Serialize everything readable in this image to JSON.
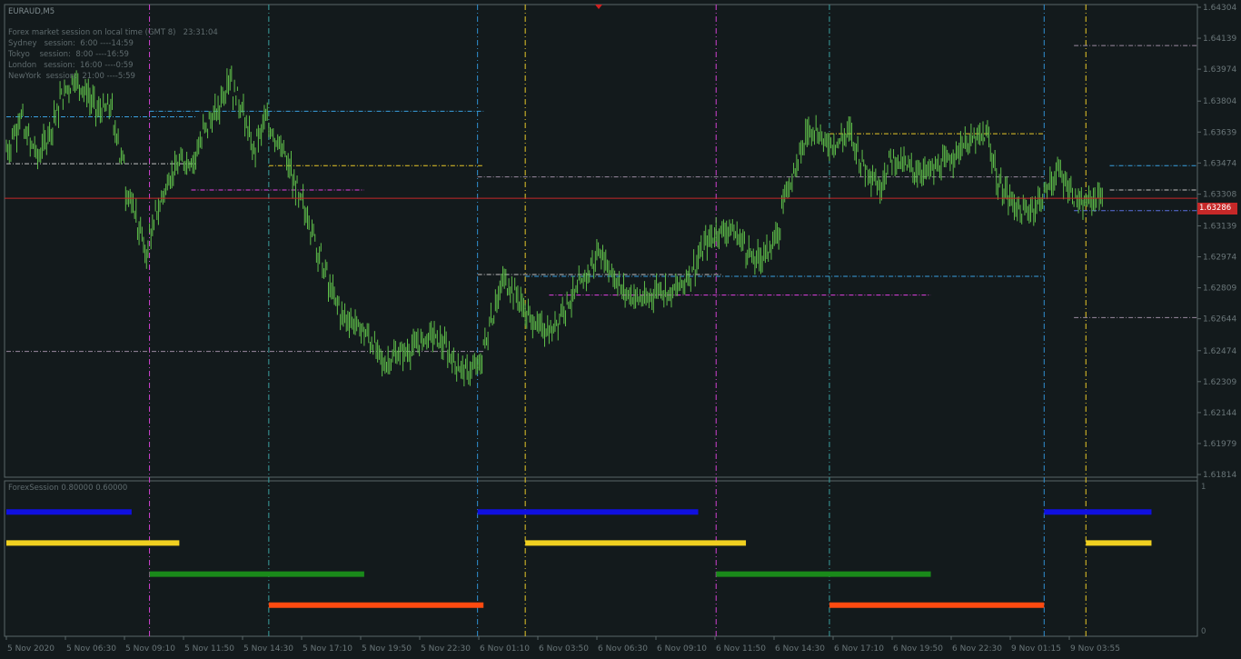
{
  "symbol": "EURAUD,M5",
  "info_lines": [
    "Forex market session on local time (GMT 8)   23:31:04",
    "Sydney   session:  6:00 ----14:59",
    "Tokyo    session:  8:00 ----16:59",
    "London   session:  16:00 ----0:59",
    "NewYork  session:  21:00 ----5:59"
  ],
  "current_price": "1.63286",
  "indicator": {
    "title": "ForexSession 0.80000 0.60000",
    "scale_top": "1",
    "scale_bottom": "0"
  },
  "colors": {
    "background": "#131a1c",
    "candle": "#5fbf4a",
    "sydney": "#1010e0",
    "tokyo": "#f0d020",
    "london": "#1a8a1a",
    "newyork": "#ff4a10",
    "price_line": "#c62828"
  },
  "chart_data": {
    "type": "bar",
    "title": "EURAUD,M5",
    "price_axis_ticks": [
      "1.64304",
      "1.64139",
      "1.63974",
      "1.63804",
      "1.63639",
      "1.63474",
      "1.63308",
      "1.63139",
      "1.62974",
      "1.62809",
      "1.62644",
      "1.62474",
      "1.62309",
      "1.62144",
      "1.61979",
      "1.61814"
    ],
    "time_axis_ticks": [
      "5 Nov 2020",
      "5 Nov 06:30",
      "5 Nov 09:10",
      "5 Nov 11:50",
      "5 Nov 14:30",
      "5 Nov 17:10",
      "5 Nov 19:50",
      "5 Nov 22:30",
      "6 Nov 01:10",
      "6 Nov 03:50",
      "6 Nov 06:30",
      "6 Nov 09:10",
      "6 Nov 11:50",
      "6 Nov 14:30",
      "6 Nov 17:10",
      "6 Nov 19:50",
      "6 Nov 22:30",
      "9 Nov 01:15",
      "9 Nov 03:55"
    ],
    "ylim": [
      1.61814,
      1.64304
    ],
    "current_price": 1.63286,
    "price_path": [
      [
        0,
        1.6355
      ],
      [
        2,
        1.6372
      ],
      [
        3,
        1.6362
      ],
      [
        5,
        1.6351
      ],
      [
        7,
        1.6365
      ],
      [
        9,
        1.6383
      ],
      [
        11,
        1.6392
      ],
      [
        13,
        1.6385
      ],
      [
        15,
        1.6375
      ],
      [
        17,
        1.6377
      ],
      [
        19,
        1.635
      ],
      [
        20,
        1.6331
      ],
      [
        21,
        1.6322
      ],
      [
        23,
        1.63
      ],
      [
        25,
        1.6322
      ],
      [
        27,
        1.634
      ],
      [
        29,
        1.6348
      ],
      [
        31,
        1.6349
      ],
      [
        33,
        1.6366
      ],
      [
        35,
        1.6375
      ],
      [
        37,
        1.6393
      ],
      [
        38,
        1.6384
      ],
      [
        39,
        1.6378
      ],
      [
        41,
        1.6354
      ],
      [
        43,
        1.637
      ],
      [
        45,
        1.636
      ],
      [
        47,
        1.6345
      ],
      [
        48,
        1.6335
      ],
      [
        50,
        1.632
      ],
      [
        52,
        1.63
      ],
      [
        54,
        1.628
      ],
      [
        56,
        1.6266
      ],
      [
        58,
        1.6262
      ],
      [
        60,
        1.6256
      ],
      [
        62,
        1.6246
      ],
      [
        63,
        1.624
      ],
      [
        65,
        1.6245
      ],
      [
        67,
        1.6247
      ],
      [
        69,
        1.6252
      ],
      [
        71,
        1.6256
      ],
      [
        73,
        1.625
      ],
      [
        75,
        1.624
      ],
      [
        77,
        1.6236
      ],
      [
        79,
        1.624
      ],
      [
        81,
        1.6265
      ],
      [
        83,
        1.6285
      ],
      [
        85,
        1.6278
      ],
      [
        87,
        1.6266
      ],
      [
        89,
        1.626
      ],
      [
        91,
        1.6257
      ],
      [
        93,
        1.627
      ],
      [
        95,
        1.6278
      ],
      [
        97,
        1.6288
      ],
      [
        99,
        1.63
      ],
      [
        101,
        1.629
      ],
      [
        103,
        1.6279
      ],
      [
        105,
        1.6276
      ],
      [
        107,
        1.6274
      ],
      [
        109,
        1.6281
      ],
      [
        111,
        1.6278
      ],
      [
        113,
        1.6283
      ],
      [
        115,
        1.6292
      ],
      [
        117,
        1.6305
      ],
      [
        119,
        1.6311
      ],
      [
        121,
        1.6312
      ],
      [
        123,
        1.6306
      ],
      [
        125,
        1.6295
      ],
      [
        127,
        1.63
      ],
      [
        129,
        1.6308
      ],
      [
        130,
        1.633
      ],
      [
        132,
        1.6345
      ],
      [
        134,
        1.6364
      ],
      [
        135,
        1.6366
      ],
      [
        137,
        1.6358
      ],
      [
        139,
        1.6358
      ],
      [
        141,
        1.6364
      ],
      [
        143,
        1.6348
      ],
      [
        145,
        1.634
      ],
      [
        146,
        1.6334
      ],
      [
        148,
        1.635
      ],
      [
        150,
        1.6347
      ],
      [
        152,
        1.6343
      ],
      [
        154,
        1.6343
      ],
      [
        156,
        1.6345
      ],
      [
        158,
        1.635
      ],
      [
        160,
        1.6357
      ],
      [
        162,
        1.636
      ],
      [
        164,
        1.6362
      ],
      [
        165,
        1.635
      ],
      [
        166,
        1.6336
      ],
      [
        168,
        1.6328
      ],
      [
        170,
        1.6321
      ],
      [
        172,
        1.6324
      ],
      [
        174,
        1.6333
      ],
      [
        176,
        1.6343
      ],
      [
        178,
        1.6333
      ],
      [
        180,
        1.6324
      ],
      [
        181,
        1.6327
      ],
      [
        183,
        1.633
      ]
    ],
    "sessions_pane": {
      "y_range": [
        0,
        1
      ],
      "series": [
        {
          "name": "Sydney",
          "level": 0.8,
          "spans": [
            [
              0,
              21
            ],
            [
              79,
              116
            ],
            [
              174,
              192
            ]
          ]
        },
        {
          "name": "Tokyo",
          "level": 0.6,
          "spans": [
            [
              0,
              29
            ],
            [
              87,
              124
            ],
            [
              181,
              192
            ]
          ]
        },
        {
          "name": "London",
          "level": 0.4,
          "spans": [
            [
              24,
              60
            ],
            [
              119,
              155
            ]
          ]
        },
        {
          "name": "NewYork",
          "level": 0.2,
          "spans": [
            [
              44,
              80
            ],
            [
              138,
              174
            ]
          ]
        }
      ]
    }
  }
}
